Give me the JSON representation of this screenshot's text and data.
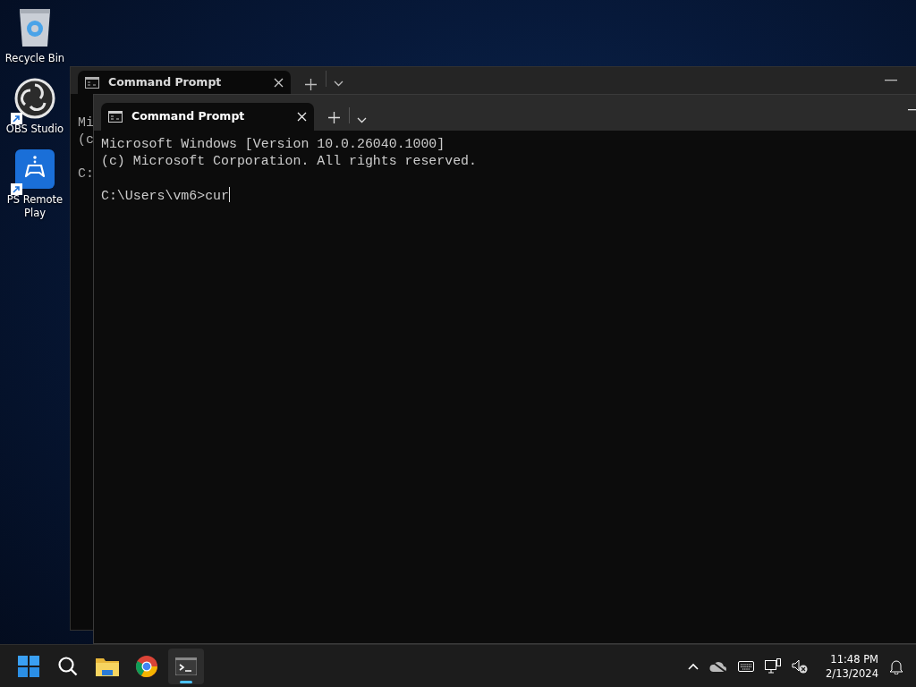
{
  "desktop_icons": [
    {
      "label": "Recycle Bin",
      "kind": "recycle",
      "shortcut": false
    },
    {
      "label": "OBS Studio",
      "kind": "obs",
      "shortcut": true
    },
    {
      "label": "PS Remote Play",
      "kind": "gamepad",
      "shortcut": true
    }
  ],
  "windows": [
    {
      "tab_title": "Command Prompt",
      "active": false,
      "cursor": false,
      "blocks": [
        [
          "Mi",
          "(c"
        ],
        [
          "C:"
        ]
      ]
    },
    {
      "tab_title": "Command Prompt",
      "active": true,
      "cursor": true,
      "blocks": [
        [
          "Microsoft Windows [Version 10.0.26040.1000]",
          "(c) Microsoft Corporation. All rights reserved."
        ],
        [
          "C:\\Users\\vm6>cur"
        ]
      ]
    }
  ],
  "taskbar": {
    "apps": [
      {
        "kind": "start",
        "selected": false
      },
      {
        "kind": "search",
        "selected": false
      },
      {
        "kind": "explorer",
        "selected": false
      },
      {
        "kind": "chrome",
        "selected": false
      },
      {
        "kind": "terminal",
        "selected": true
      }
    ],
    "tray": {
      "time": "11:48 PM",
      "date": "2/13/2024"
    }
  }
}
